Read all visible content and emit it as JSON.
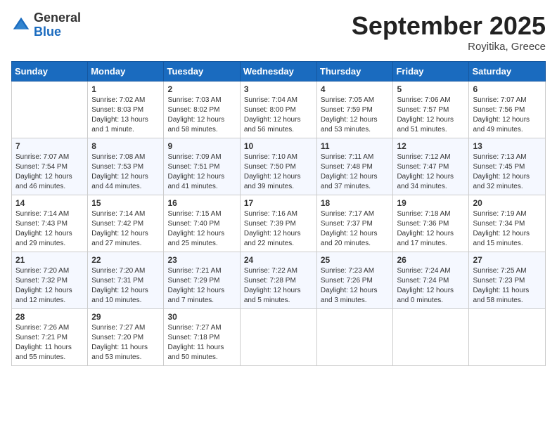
{
  "header": {
    "logo_general": "General",
    "logo_blue": "Blue",
    "month_title": "September 2025",
    "location": "Royitika, Greece"
  },
  "days_of_week": [
    "Sunday",
    "Monday",
    "Tuesday",
    "Wednesday",
    "Thursday",
    "Friday",
    "Saturday"
  ],
  "weeks": [
    [
      {
        "day": "",
        "info": ""
      },
      {
        "day": "1",
        "info": "Sunrise: 7:02 AM\nSunset: 8:03 PM\nDaylight: 13 hours\nand 1 minute."
      },
      {
        "day": "2",
        "info": "Sunrise: 7:03 AM\nSunset: 8:02 PM\nDaylight: 12 hours\nand 58 minutes."
      },
      {
        "day": "3",
        "info": "Sunrise: 7:04 AM\nSunset: 8:00 PM\nDaylight: 12 hours\nand 56 minutes."
      },
      {
        "day": "4",
        "info": "Sunrise: 7:05 AM\nSunset: 7:59 PM\nDaylight: 12 hours\nand 53 minutes."
      },
      {
        "day": "5",
        "info": "Sunrise: 7:06 AM\nSunset: 7:57 PM\nDaylight: 12 hours\nand 51 minutes."
      },
      {
        "day": "6",
        "info": "Sunrise: 7:07 AM\nSunset: 7:56 PM\nDaylight: 12 hours\nand 49 minutes."
      }
    ],
    [
      {
        "day": "7",
        "info": "Sunrise: 7:07 AM\nSunset: 7:54 PM\nDaylight: 12 hours\nand 46 minutes."
      },
      {
        "day": "8",
        "info": "Sunrise: 7:08 AM\nSunset: 7:53 PM\nDaylight: 12 hours\nand 44 minutes."
      },
      {
        "day": "9",
        "info": "Sunrise: 7:09 AM\nSunset: 7:51 PM\nDaylight: 12 hours\nand 41 minutes."
      },
      {
        "day": "10",
        "info": "Sunrise: 7:10 AM\nSunset: 7:50 PM\nDaylight: 12 hours\nand 39 minutes."
      },
      {
        "day": "11",
        "info": "Sunrise: 7:11 AM\nSunset: 7:48 PM\nDaylight: 12 hours\nand 37 minutes."
      },
      {
        "day": "12",
        "info": "Sunrise: 7:12 AM\nSunset: 7:47 PM\nDaylight: 12 hours\nand 34 minutes."
      },
      {
        "day": "13",
        "info": "Sunrise: 7:13 AM\nSunset: 7:45 PM\nDaylight: 12 hours\nand 32 minutes."
      }
    ],
    [
      {
        "day": "14",
        "info": "Sunrise: 7:14 AM\nSunset: 7:43 PM\nDaylight: 12 hours\nand 29 minutes."
      },
      {
        "day": "15",
        "info": "Sunrise: 7:14 AM\nSunset: 7:42 PM\nDaylight: 12 hours\nand 27 minutes."
      },
      {
        "day": "16",
        "info": "Sunrise: 7:15 AM\nSunset: 7:40 PM\nDaylight: 12 hours\nand 25 minutes."
      },
      {
        "day": "17",
        "info": "Sunrise: 7:16 AM\nSunset: 7:39 PM\nDaylight: 12 hours\nand 22 minutes."
      },
      {
        "day": "18",
        "info": "Sunrise: 7:17 AM\nSunset: 7:37 PM\nDaylight: 12 hours\nand 20 minutes."
      },
      {
        "day": "19",
        "info": "Sunrise: 7:18 AM\nSunset: 7:36 PM\nDaylight: 12 hours\nand 17 minutes."
      },
      {
        "day": "20",
        "info": "Sunrise: 7:19 AM\nSunset: 7:34 PM\nDaylight: 12 hours\nand 15 minutes."
      }
    ],
    [
      {
        "day": "21",
        "info": "Sunrise: 7:20 AM\nSunset: 7:32 PM\nDaylight: 12 hours\nand 12 minutes."
      },
      {
        "day": "22",
        "info": "Sunrise: 7:20 AM\nSunset: 7:31 PM\nDaylight: 12 hours\nand 10 minutes."
      },
      {
        "day": "23",
        "info": "Sunrise: 7:21 AM\nSunset: 7:29 PM\nDaylight: 12 hours\nand 7 minutes."
      },
      {
        "day": "24",
        "info": "Sunrise: 7:22 AM\nSunset: 7:28 PM\nDaylight: 12 hours\nand 5 minutes."
      },
      {
        "day": "25",
        "info": "Sunrise: 7:23 AM\nSunset: 7:26 PM\nDaylight: 12 hours\nand 3 minutes."
      },
      {
        "day": "26",
        "info": "Sunrise: 7:24 AM\nSunset: 7:24 PM\nDaylight: 12 hours\nand 0 minutes."
      },
      {
        "day": "27",
        "info": "Sunrise: 7:25 AM\nSunset: 7:23 PM\nDaylight: 11 hours\nand 58 minutes."
      }
    ],
    [
      {
        "day": "28",
        "info": "Sunrise: 7:26 AM\nSunset: 7:21 PM\nDaylight: 11 hours\nand 55 minutes."
      },
      {
        "day": "29",
        "info": "Sunrise: 7:27 AM\nSunset: 7:20 PM\nDaylight: 11 hours\nand 53 minutes."
      },
      {
        "day": "30",
        "info": "Sunrise: 7:27 AM\nSunset: 7:18 PM\nDaylight: 11 hours\nand 50 minutes."
      },
      {
        "day": "",
        "info": ""
      },
      {
        "day": "",
        "info": ""
      },
      {
        "day": "",
        "info": ""
      },
      {
        "day": "",
        "info": ""
      }
    ]
  ]
}
